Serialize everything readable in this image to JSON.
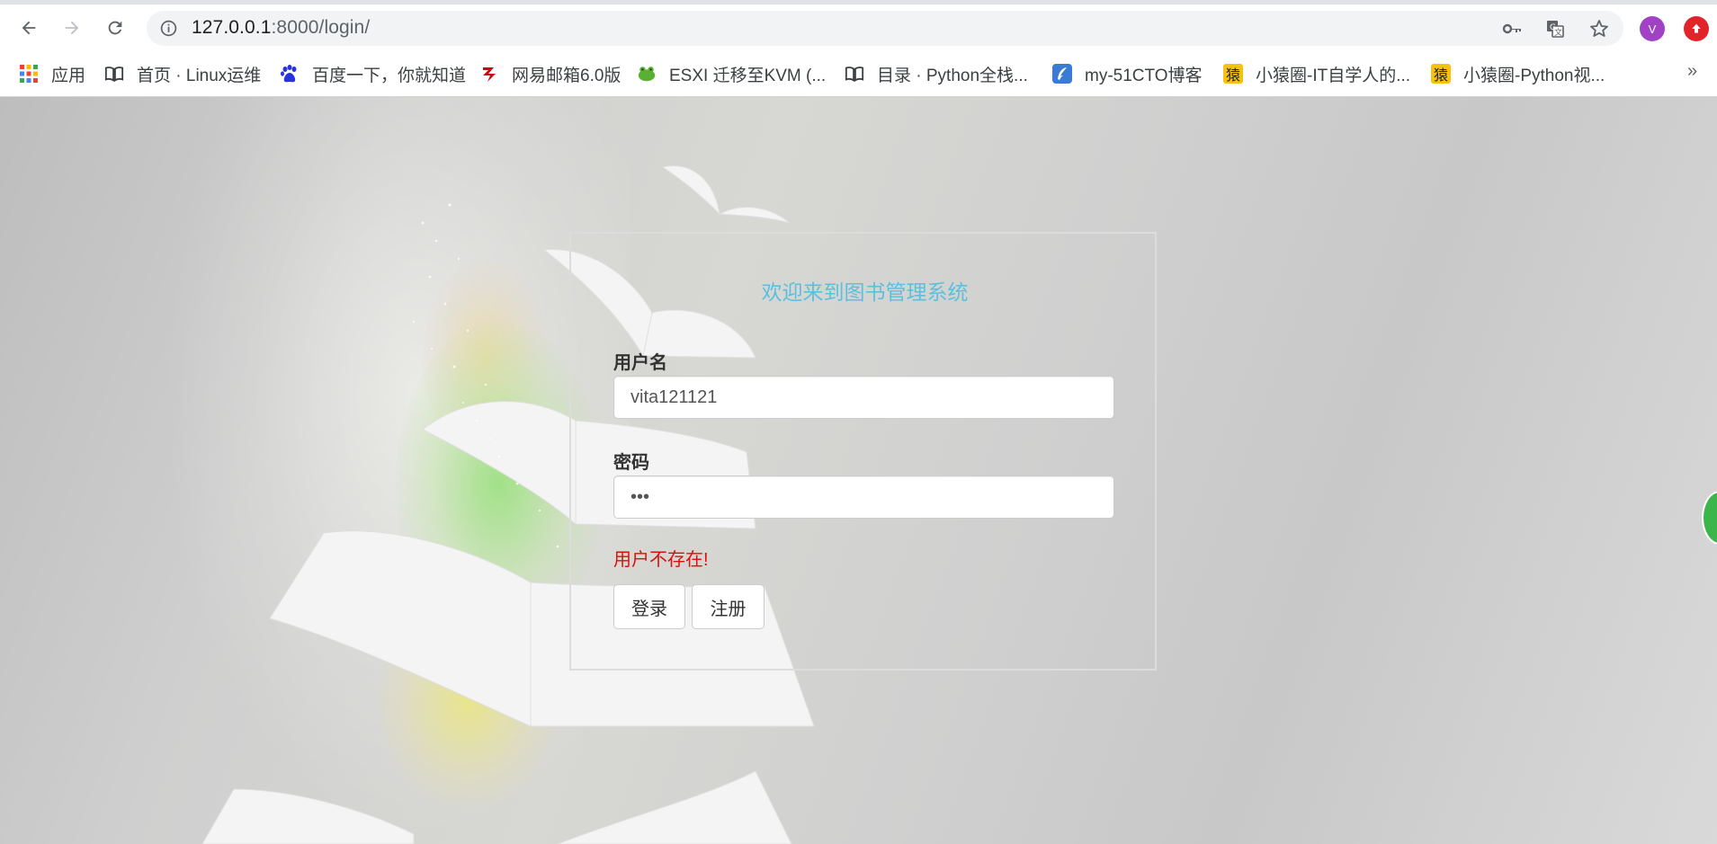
{
  "browser": {
    "url_host": "127.0.0.1",
    "url_rest": ":8000/login/",
    "profile_initial": "V"
  },
  "bookmarks": [
    {
      "icon": "apps-grid-icon",
      "label": "应用"
    },
    {
      "icon": "book-icon",
      "label": "首页 · Linux运维"
    },
    {
      "icon": "baidu-paw-icon",
      "label": "百度一下，你就知道"
    },
    {
      "icon": "netease-mail-icon",
      "label": "网易邮箱6.0版"
    },
    {
      "icon": "frog-icon",
      "label": "ESXI 迁移至KVM (..."
    },
    {
      "icon": "book-icon",
      "label": "目录 · Python全栈..."
    },
    {
      "icon": "feather-icon",
      "label": "my-51CTO博客"
    },
    {
      "icon": "yuanquan-icon",
      "label": "小猿圈-IT自学人的..."
    },
    {
      "icon": "yuanquan-icon",
      "label": "小猿圈-Python视..."
    }
  ],
  "bookmark_icon_glyph": "猿",
  "login": {
    "title": "欢迎来到图书管理系统",
    "username_label": "用户名",
    "username_value": "vita121121",
    "password_label": "密码",
    "password_value": "•••",
    "error": "用户不存在!",
    "login_button": "登录",
    "register_button": "注册"
  },
  "colors": {
    "title": "#5bc0de",
    "error": "#d9100b",
    "avatar": "#a142c6"
  }
}
